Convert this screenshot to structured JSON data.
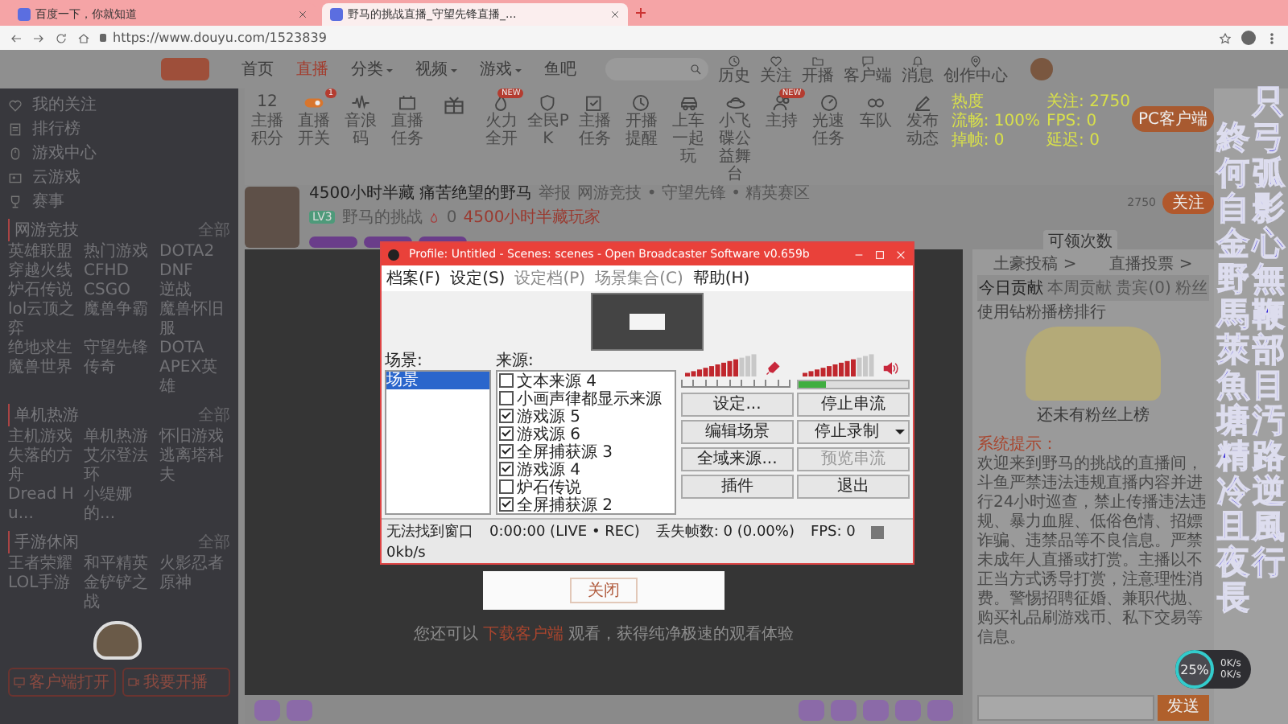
{
  "browser": {
    "tabs": [
      {
        "title": "百度一下，你就知道",
        "selected": false
      },
      {
        "title": "野马的挑战直播_守望先锋直播_...",
        "selected": true
      }
    ],
    "url": "https://www.douyu.com/1523839"
  },
  "site_header": {
    "nav": [
      {
        "label": "首页",
        "selected": false,
        "dropdown": false
      },
      {
        "label": "直播",
        "selected": true,
        "dropdown": false
      },
      {
        "label": "分类",
        "selected": false,
        "dropdown": true
      },
      {
        "label": "视频",
        "selected": false,
        "dropdown": true
      },
      {
        "label": "游戏",
        "selected": false,
        "dropdown": true
      },
      {
        "label": "鱼吧",
        "selected": false,
        "dropdown": false
      }
    ],
    "icons": [
      "历史",
      "关注",
      "开播",
      "客户端",
      "消息",
      "创作中心"
    ]
  },
  "sidebar": {
    "links": [
      "我的关注",
      "排行榜",
      "游戏中心",
      "云游戏",
      "赛事"
    ],
    "sections": [
      {
        "title": "网游竞技",
        "more": "全部",
        "items": [
          "英雄联盟",
          "热门游戏",
          "DOTA2",
          "穿越火线",
          "CFHD",
          "DNF",
          "炉石传说",
          "CSGO",
          "逆战",
          "lol云顶之弈",
          "魔兽争霸",
          "魔兽怀旧服",
          "绝地求生",
          "守望先锋",
          "DOTA",
          "魔兽世界",
          "传奇",
          "APEX英雄"
        ]
      },
      {
        "title": "单机热游",
        "more": "全部",
        "items": [
          "主机游戏",
          "单机热游",
          "怀旧游戏",
          "失落的方舟",
          "艾尔登法环",
          "逃离塔科夫",
          "Dread Hu...",
          "小缇娜的..."
        ]
      },
      {
        "title": "手游休闲",
        "more": "全部",
        "items": [
          "王者荣耀",
          "和平精英",
          "火影忍者",
          "LOL手游",
          "金铲铲之战",
          "原神"
        ]
      }
    ],
    "buttons": [
      "客户端打开",
      "我要开播"
    ]
  },
  "toolbar": {
    "stat": {
      "value": "12",
      "label": "主播积分"
    },
    "items": [
      {
        "kind": "labeled",
        "label": "直播开关",
        "badge": "1"
      },
      {
        "kind": "labeled",
        "label": "音浪码"
      },
      {
        "kind": "labeled",
        "label": "直播任务"
      },
      {
        "kind": "icon"
      },
      {
        "kind": "labeled",
        "label": "火力全开",
        "badge": "NEW"
      },
      {
        "kind": "labeled",
        "label": "全民PK"
      },
      {
        "kind": "labeled",
        "label": "主播任务"
      },
      {
        "kind": "labeled",
        "label": "开播提醒"
      },
      {
        "kind": "labeled",
        "label": "上车一起玩"
      },
      {
        "kind": "labeled",
        "label": "小飞碟公益舞台"
      },
      {
        "kind": "labeled",
        "label": "主持",
        "badge": "NEW"
      },
      {
        "kind": "labeled",
        "label": "光速任务"
      },
      {
        "kind": "labeled",
        "label": "车队"
      },
      {
        "kind": "labeled",
        "label": "发布动态"
      }
    ],
    "stats": [
      "热度",
      "关注: 2750",
      "流畅: 100%",
      "FPS: 0",
      "掉帧: 0",
      "延迟: 0"
    ],
    "client_button": "PC客户端"
  },
  "room": {
    "title": "4500小时半藏 痛苦绝望的野马",
    "report": "举报",
    "breadcrumb": "网游竞技 • 守望先锋 • 精英赛区",
    "level": "LV3",
    "streamer": "野马的挑战",
    "hot": "0",
    "tag": "4500小时半藏玩家",
    "follow_count": "2750",
    "follow_button": "关注",
    "claim": "可领次数"
  },
  "video": {
    "close_button": "关闭",
    "notice": "您还可以 **下载客户端** 观看，获得纯净极速的观看体验"
  },
  "right_panel": {
    "links": [
      "土豪投稿 >",
      "直播投票 >"
    ],
    "tabs": [
      {
        "label": "今日贡献",
        "selected": true
      },
      {
        "label": "本周贡献",
        "selected": false
      },
      {
        "label": "贵宾(0)",
        "selected": false
      },
      {
        "label": "粉丝",
        "selected": false
      }
    ],
    "note": "使用钻粉播榜排行",
    "empty": "还未有粉丝上榜",
    "system_label": "系统提示：",
    "system_message": "欢迎来到野马的挑战的直播间，斗鱼严禁违法违规直播内容并进行24小时巡查，禁止传播违法违规、暴力血腥、低俗色情、招嫖诈骗、违禁品等不良信息。严禁未成年人直播或打赏。主播以不正当方式诱导打赏，注意理性消费。警惕招聘征婚、兼职代抛、购买礼品刷游戏币、私下交易等信息。",
    "send_button": "发送"
  },
  "speed_widget": {
    "percent": "25%",
    "upload": "0K/s",
    "download": "0K/s"
  },
  "obs": {
    "title": "Profile: Untitled - Scenes: scenes - Open Broadcaster Software v0.659b",
    "menu": [
      {
        "label": "档案(F)",
        "disabled": false
      },
      {
        "label": "设定(S)",
        "disabled": false
      },
      {
        "label": "设定档(P)",
        "disabled": true
      },
      {
        "label": "场景集合(C)",
        "disabled": true
      },
      {
        "label": "帮助(H)",
        "disabled": false
      }
    ],
    "scenes_label": "场景:",
    "scenes": [
      {
        "label": "场景",
        "selected": true
      }
    ],
    "sources_label": "来源:",
    "sources": [
      {
        "label": "文本来源 4",
        "checked": false
      },
      {
        "label": "小画声律都显示来源",
        "checked": false
      },
      {
        "label": "游戏源 5",
        "checked": true
      },
      {
        "label": "游戏源 6",
        "checked": true
      },
      {
        "label": "全屏捕获源 3",
        "checked": true
      },
      {
        "label": "游戏源 4",
        "checked": true
      },
      {
        "label": "炉石传说",
        "checked": false
      },
      {
        "label": "全屏捕获源 2",
        "checked": true
      }
    ],
    "desktop_level": {
      "level": 0.25
    },
    "buttons": [
      {
        "label": "设定...",
        "disabled": false,
        "dropdown": false
      },
      {
        "label": "停止串流",
        "disabled": false,
        "dropdown": false
      },
      {
        "label": "编辑场景",
        "disabled": false,
        "dropdown": false
      },
      {
        "label": "停止录制",
        "disabled": false,
        "dropdown": true
      },
      {
        "label": "全域来源...",
        "disabled": false,
        "dropdown": false
      },
      {
        "label": "预览串流",
        "disabled": true,
        "dropdown": false
      },
      {
        "label": "插件",
        "disabled": false,
        "dropdown": false
      },
      {
        "label": "退出",
        "disabled": false,
        "dropdown": false
      }
    ],
    "status": [
      "无法找到窗口",
      "0:00:00 (LIVE • REC)",
      "丢失帧数: 0 (0.00%)",
      "FPS: 0",
      "0kb/s"
    ]
  },
  "overlay_text": [
    "終何自金野馬萊魚塘精冷且夜長",
    "只弓弧影心無鞭部目汚路逆風行"
  ]
}
